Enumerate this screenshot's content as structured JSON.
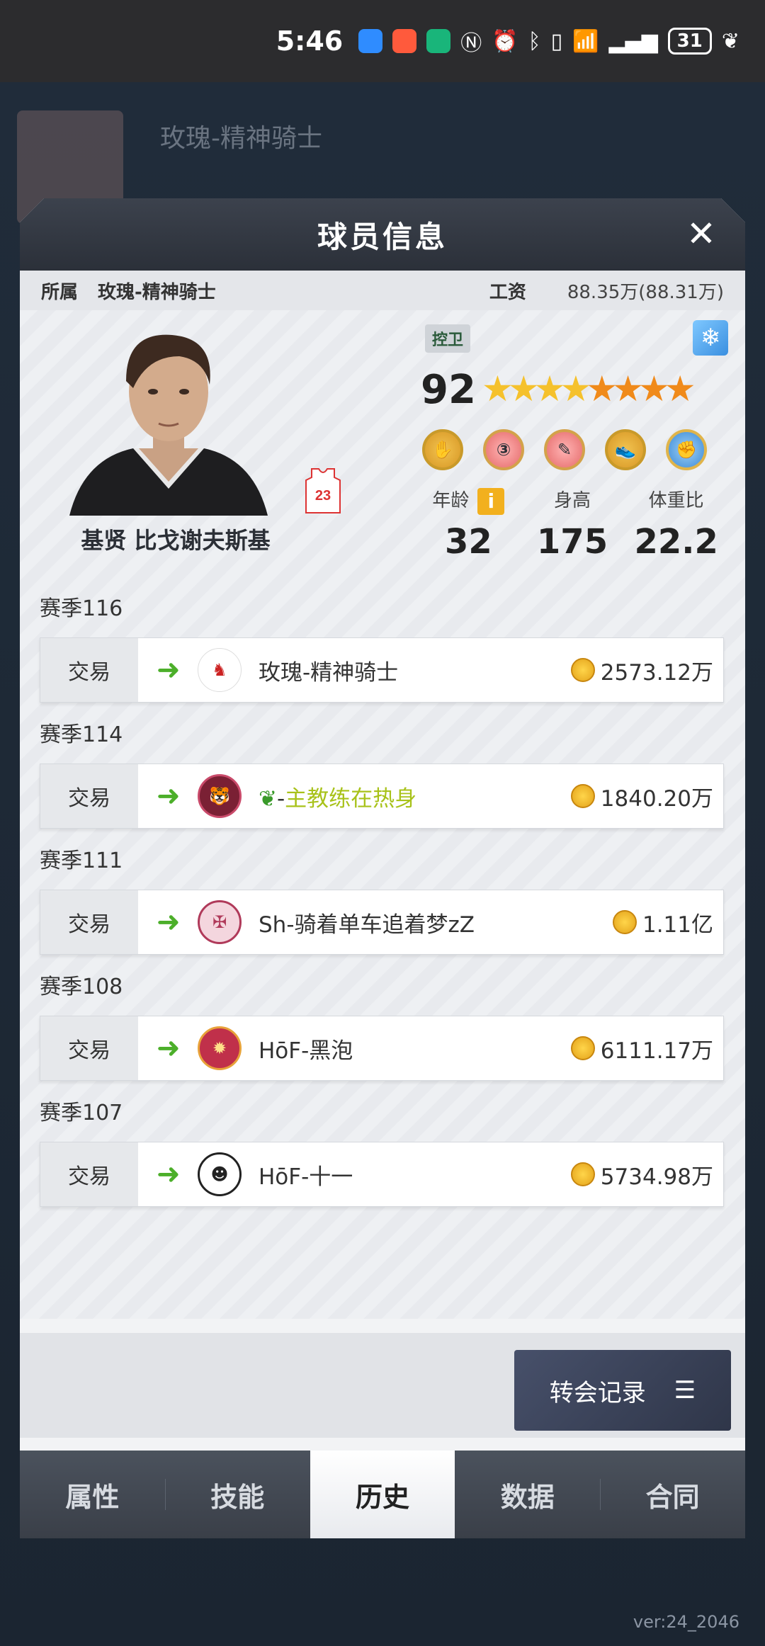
{
  "status_bar": {
    "time": "5:46",
    "battery": "31"
  },
  "background": {
    "title": "玫瑰-精神骑士",
    "version": "ver:24_2046"
  },
  "modal": {
    "title": "球员信息",
    "info_bar": {
      "team_label": "所属",
      "team": "玫瑰-精神骑士",
      "salary_label": "工资",
      "salary": "88.35万(88.31万)"
    },
    "player": {
      "name": "基贤 比戈谢夫斯基",
      "jersey_number": "23",
      "position": "控卫",
      "rating": "92",
      "stars": 8,
      "age_label": "年龄",
      "age": "32",
      "height_label": "身高",
      "height": "175",
      "bmi_label": "体重比",
      "bmi": "22.2"
    },
    "history": [
      {
        "season": "赛季116",
        "type": "交易",
        "team": "玫瑰-精神骑士",
        "price": "2573.12万"
      },
      {
        "season": "赛季114",
        "type": "交易",
        "team_prefix": "-",
        "team": "主教练在热身",
        "price": "1840.20万"
      },
      {
        "season": "赛季111",
        "type": "交易",
        "team": "Sh-骑着单车追着梦zZ",
        "price": "1.11亿"
      },
      {
        "season": "赛季108",
        "type": "交易",
        "team": "HōF-黑泡",
        "price": "6111.17万"
      },
      {
        "season": "赛季107",
        "type": "交易",
        "team": "HōF-十一",
        "price": "5734.98万"
      }
    ],
    "transfer_log_label": "转会记录",
    "tabs": [
      {
        "label": "属性"
      },
      {
        "label": "技能"
      },
      {
        "label": "历史"
      },
      {
        "label": "数据"
      },
      {
        "label": "合同"
      }
    ]
  }
}
